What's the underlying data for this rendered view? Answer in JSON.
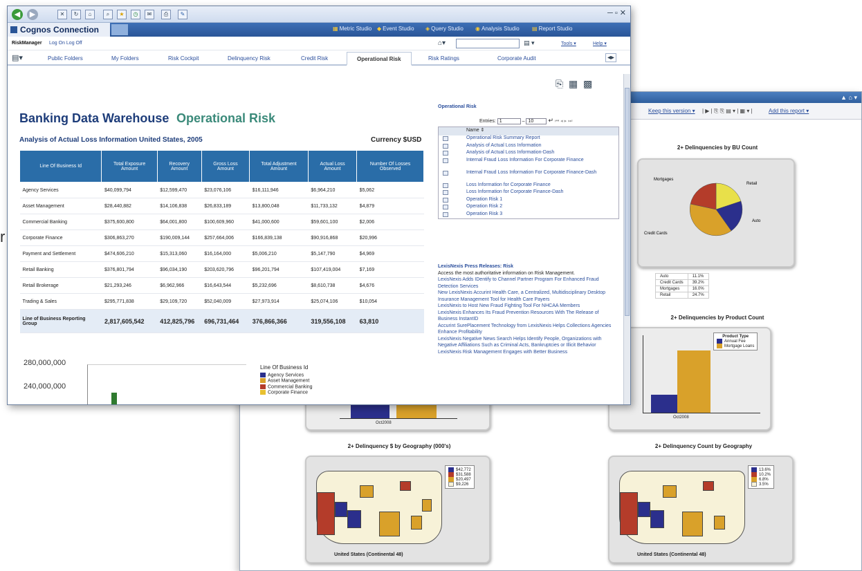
{
  "stray_text": "r",
  "front": {
    "app_title": "Cognos Connection",
    "studios": [
      "Metric Studio",
      "Event Studio",
      "Query Studio",
      "Analysis Studio",
      "Report Studio"
    ],
    "user": "RiskManager",
    "log_links": "Log On  Log Off",
    "tools": "Tools ▾",
    "help": "Help ▾",
    "tabs": [
      "Public Folders",
      "My Folders",
      "Risk Cockpit",
      "Delinquency Risk",
      "Credit Risk",
      "Operational Risk",
      "Risk Ratings",
      "Corporate Audit"
    ],
    "active_tab": "Operational Risk",
    "title": "Banking Data Warehouse",
    "subtitle": "Operational Risk",
    "analysis_title": "Analysis of Actual Loss Information United States, 2005",
    "currency": "Currency $USD",
    "table": {
      "headers": [
        "Line Of Business Id",
        "Total Exposure Amount",
        "Recovery Amount",
        "Gross Loss Amount",
        "Total Adjustment Amount",
        "Actual Loss Amount",
        "Number Of Losses Observed"
      ],
      "rows": [
        [
          "Agency Services",
          "$40,099,794",
          "$12,599,470",
          "$23,076,106",
          "$16,111,946",
          "$6,964,210",
          "$5,062"
        ],
        [
          "Asset Management",
          "$28,440,882",
          "$14,106,838",
          "$26,833,189",
          "$13,800,048",
          "$11,733,132",
          "$4,879"
        ],
        [
          "Commercial Banking",
          "$375,600,800",
          "$64,001,800",
          "$100,609,960",
          "$41,000,600",
          "$59,601,100",
          "$2,006"
        ],
        [
          "Corporate Finance",
          "$306,863,270",
          "$190,009,144",
          "$257,664,006",
          "$166,839,138",
          "$90,916,868",
          "$20,996"
        ],
        [
          "Payment and Settlement",
          "$474,606,210",
          "$15,313,060",
          "$16,164,000",
          "$5,006,210",
          "$5,147,790",
          "$4,969"
        ],
        [
          "Retail Banking",
          "$376,801,794",
          "$96,034,190",
          "$203,620,796",
          "$96,201,794",
          "$107,419,004",
          "$7,169"
        ],
        [
          "Retail Brokerage",
          "$21,293,246",
          "$6,962,966",
          "$16,643,544",
          "$5,232,696",
          "$8,610,738",
          "$4,676"
        ],
        [
          "Trading & Sales",
          "$295,771,838",
          "$29,109,720",
          "$52,040,009",
          "$27,973,914",
          "$25,074,106",
          "$10,054"
        ]
      ],
      "total": [
        "Line of Business Reporting Group",
        "2,817,605,542",
        "412,825,796",
        "696,731,464",
        "376,866,366",
        "319,556,108",
        "63,810"
      ]
    },
    "chart_y_labels": [
      "280,000,000",
      "240,000,000"
    ],
    "legend_title": "Line Of Business Id",
    "legend_items": [
      "Agency Services",
      "Asset Management",
      "Commercial Banking",
      "Corporate Finance"
    ],
    "right": {
      "title": "Operational Risk",
      "entries_label": "Entries:",
      "entries_from": "1",
      "entries_to": "10",
      "name_header": "Name ⇕",
      "reports": [
        "Operational Risk Summary Report",
        "Analysis of Actual Loss Information",
        "Analysis of Actual Loss Information-Dash",
        "Internal Fraud Loss Information For Corporate Finance",
        "Internal Fraud Loss Information For Corporate Finance-Dash",
        "Loss Information for Corporate Finance",
        "Loss Information for Corporate Finance-Dash",
        "Operation Risk 1",
        "Operation Risk 2",
        "Operation Risk 3"
      ],
      "press_title": "LexisNexis Press Releases: Risk",
      "press_intro": "Access the most authoritative information on Risk Management.",
      "press_links": [
        "LexisNexis Adds IDentify to Channel Partner Program For Enhanced Fraud Detection Services",
        "New LexisNexis Accurint Health Care, a Centralized, Multidisciplinary Desktop Insurance Management Tool for Health Care Payers",
        "LexisNexis to Host New Fraud Fighting Tool For NHCAA Members",
        "LexisNexis Enhances Its Fraud Prevention Resources With The Release of Business InstantID",
        "Accurint SurePlacement Technology from LexisNexis Helps Collections Agencies Enhance Profitability",
        "LexisNexis Negative News Search Helps Identify People, Organizations with Negative Affiliations Such as Criminal Acts, Bankruptcies or Illicit Behavior",
        "LexisNexis Risk Management Engages with Better Business"
      ]
    }
  },
  "back": {
    "toolbar_left": "Keep this version ▾",
    "toolbar_right": "Add this report ▾",
    "pie_title": "2+ Delinquencies by BU Count",
    "pie_labels": [
      "Mortgages",
      "Retail",
      "Auto",
      "Credit Cards"
    ],
    "pie_values": [
      "16.0%",
      "24.7%",
      "11.1%",
      "39.2%"
    ],
    "pie_table": [
      [
        "Auto",
        "11.1%"
      ],
      [
        "Credit Cards",
        "39.2%"
      ],
      [
        "Mortgages",
        "16.0%"
      ],
      [
        "Retail",
        "24.7%"
      ]
    ],
    "bar_title": "2+ Delinquencies by Product Count",
    "bar_legend_title": "Product Type",
    "bar_legend": [
      "Annual Fee",
      "Mortgage Loans"
    ],
    "bar_xlabel": "Oct2008",
    "geo_amount_title": "2+ Delinquency $ by Geography  (000's)",
    "geo_amount_legend": [
      "$42,772",
      "$31,588",
      "$20,497",
      "$9,226"
    ],
    "geo_count_title": "2+ Delinquency Count by Geography",
    "geo_count_legend": [
      "13.6%",
      "10.2%",
      "6.8%",
      "3.5%"
    ],
    "map_caption": "United States (Continental 48)",
    "colors": {
      "navy": "#2b2f8c",
      "orange": "#d9a12a",
      "red": "#b43c2a",
      "yellow": "#e8e04a",
      "cream": "#f7f2d8"
    }
  }
}
